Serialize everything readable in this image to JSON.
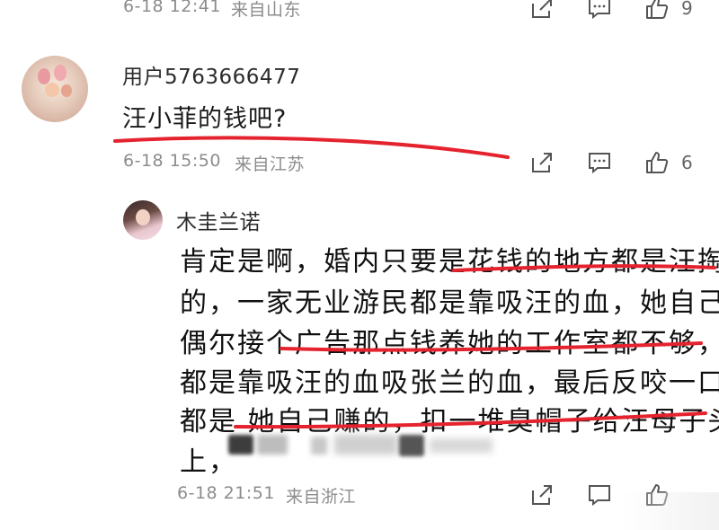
{
  "top_comment_meta": {
    "date_time": "6-18 12:41",
    "location": "来自山东",
    "like_count": "9"
  },
  "comment1": {
    "username": "用户5763666477",
    "text": "汪小菲的钱吧?",
    "date_time": "6-18 15:50",
    "location": "来自江苏",
    "like_count": "6"
  },
  "reply": {
    "username": "木圭兰诺",
    "lines": [
      "肯定是啊，婚内只要是花钱的地方都是汪掏",
      "的，一家无业游民都是靠吸汪的血，她自己",
      "偶尔接个广告那点钱养她的工作室都不够，",
      "都是靠吸汪的血吸张兰的血，最后反咬一口",
      "都是 她自己赚的，扣一堆臭帽子给汪母子头",
      "上，"
    ],
    "date_time": "6-18 21:51",
    "location": "来自浙江"
  },
  "colors": {
    "underline_red": "#e5232e",
    "meta_gray": "#8c8c8c"
  },
  "icons": [
    "share-icon",
    "comment-icon",
    "like-icon"
  ]
}
